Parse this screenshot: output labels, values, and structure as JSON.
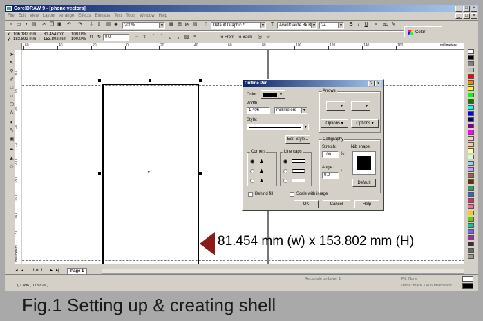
{
  "window": {
    "title": "CorelDRAW 9 - [phone vectors]"
  },
  "menu": [
    "File",
    "Edit",
    "View",
    "Layout",
    "Arrange",
    "Effects",
    "Bitmaps",
    "Text",
    "Tools",
    "Window",
    "Help"
  ],
  "property_bar": {
    "x": "106.182 mm",
    "y": "183.892 mm",
    "width": "81.454 mm",
    "height": "153.802 mm",
    "scale_x": "100.0",
    "scale_y": "100.0",
    "pct": "%",
    "rotation": "0.0",
    "to_front": "To Front",
    "to_back": "To Back"
  },
  "standard_bar": {
    "zoom": "200%",
    "style": "Default Graphic *",
    "font": "AvantGarde Bk BT",
    "font_size": "24",
    "color_label": "Color"
  },
  "ruler": {
    "h_ticks": [
      "60",
      "40",
      "20",
      "0",
      "20",
      "40",
      "60",
      "80",
      "100",
      "120",
      "140",
      "160"
    ],
    "v_ticks": [
      "300",
      "280",
      "260",
      "240",
      "220",
      "200",
      "180",
      "160",
      "140",
      "120",
      "100"
    ],
    "unit": "millimeters",
    "v_unit": "millimeters"
  },
  "page_nav": {
    "page_count": "1 of 1",
    "tab": "Page 1"
  },
  "status": {
    "coords": "( 1.496 , 173.829 )",
    "object": "Rectangle on Layer 1",
    "fill": "Fill: None",
    "outline": "Outline: Black  1.406 millimeters"
  },
  "dialog": {
    "title": "Outline Pen",
    "help": "?",
    "close": "x",
    "color_label": "Color:",
    "width_label": "Width:",
    "width_value": "1.406",
    "width_unit": "millimeters",
    "style_label": "Style:",
    "edit_style": "Edit Style...",
    "corners_label": "Corners",
    "line_caps_label": "Line caps",
    "arrows_label": "Arrows",
    "options_left": "Options",
    "options_right": "Options",
    "calligraphy_label": "Calligraphy",
    "stretch_label": "Stretch:",
    "stretch_value": "100",
    "stretch_unit": "%",
    "angle_label": "Angle:",
    "angle_value": "0.0",
    "angle_unit": "°",
    "nib_shape_label": "Nib shape:",
    "default": "Default",
    "behind_fill": "Behind fill",
    "scale_with_image": "Scale with image",
    "ok": "OK",
    "cancel": "Cancel",
    "help_btn": "Help"
  },
  "annotation": "81.454 mm (w) x 153.802 mm (H)",
  "caption": "Fig.1  Setting up & creating shell",
  "colors": {
    "title_blue": "#0a246a",
    "marker_red": "#8b1a1a",
    "palette": [
      "#ffffff",
      "#000000",
      "#808080",
      "#c0c0c0",
      "#ff0000",
      "#ff8000",
      "#ffff00",
      "#00ff00",
      "#008000",
      "#00ffff",
      "#0000ff",
      "#000080",
      "#800080",
      "#ff00ff",
      "#ffcccc",
      "#ffcc99",
      "#ffff99",
      "#ccffcc",
      "#99ccff",
      "#cc99ff",
      "#996633",
      "#663300",
      "#339966",
      "#3366cc",
      "#cc3366",
      "#ff6699",
      "#ffcc00",
      "#66cc00",
      "#00cc99",
      "#6666ff",
      "#993399",
      "#333333",
      "#666666",
      "#999999"
    ]
  }
}
